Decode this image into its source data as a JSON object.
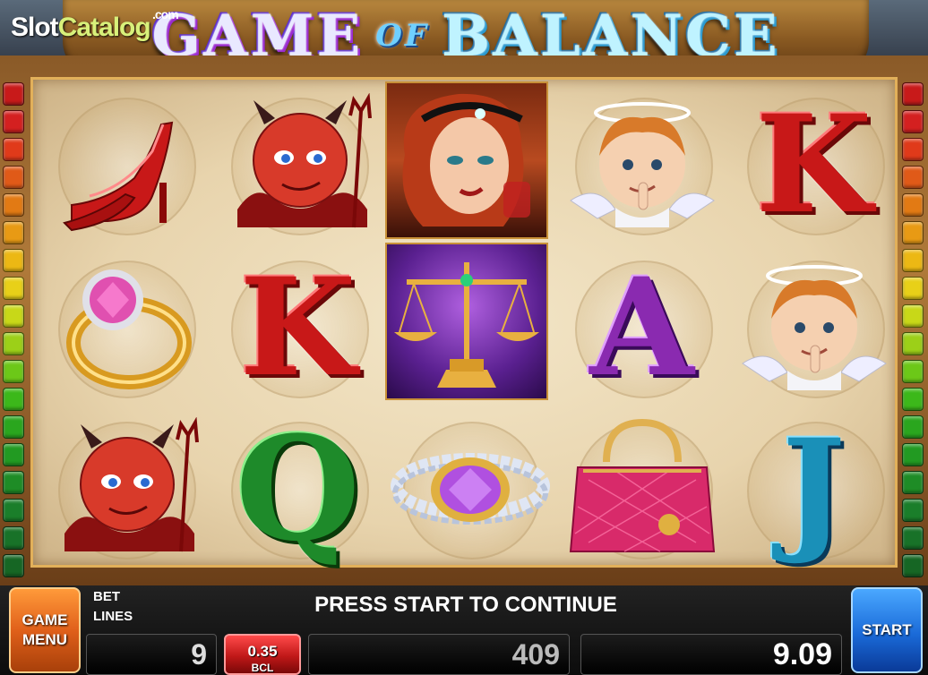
{
  "watermark": {
    "part1": "Slot",
    "part2": "Catalog",
    "part3": ".com"
  },
  "title": {
    "word1": "GAME",
    "word2": "OF",
    "word3": "BALANCE"
  },
  "reels": {
    "letters": {
      "k1": "K",
      "k2": "K",
      "a": "A",
      "q": "Q",
      "j": "J"
    },
    "symbols": [
      "red-shoe",
      "devil",
      "lady",
      "angel",
      "k",
      "ring",
      "k",
      "scales",
      "a",
      "angel",
      "devil",
      "q",
      "bracelet",
      "handbag",
      "j"
    ]
  },
  "indicator_colors": [
    "#c81a1a",
    "#d42020",
    "#e03a1a",
    "#e05a18",
    "#e27a14",
    "#e89a14",
    "#ecb814",
    "#e8d018",
    "#c8d818",
    "#9cd018",
    "#6cc818",
    "#3cb81a",
    "#2aa61e",
    "#229a22",
    "#1e8c26",
    "#1a7e2a",
    "#187228",
    "#166624"
  ],
  "panel": {
    "menu_label": "GAME\nMENU",
    "start_label": "START",
    "bet_label": "BET",
    "lines_label": "LINES",
    "message": "PRESS START TO CONTINUE",
    "lines_value": "9",
    "bet_value": "0.35",
    "bet_unit": "BCL",
    "credit_value": "409",
    "win_value": "9.09"
  }
}
